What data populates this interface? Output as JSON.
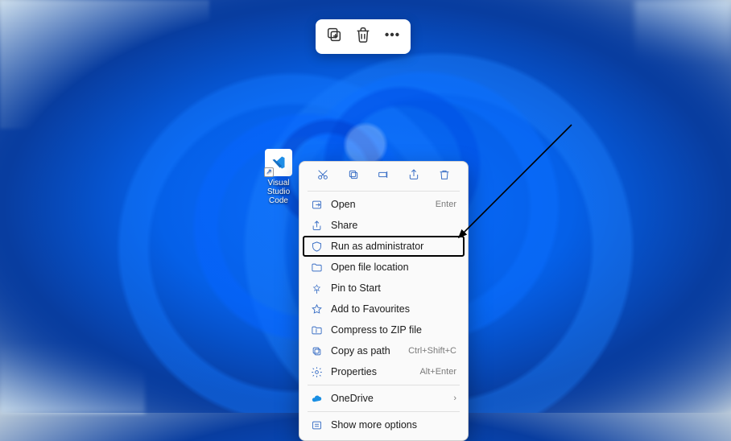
{
  "overlay_toolbar": {
    "icons": [
      "copy-add-icon",
      "trash-icon",
      "more-icon"
    ]
  },
  "desktop_icon": {
    "label": "Visual Studio Code"
  },
  "context_menu": {
    "top_icons": [
      "cut-icon",
      "copy-icon",
      "rename-icon",
      "share-icon",
      "delete-icon"
    ],
    "items": [
      {
        "icon": "open-icon",
        "label": "Open",
        "shortcut": "Enter"
      },
      {
        "icon": "share-icon",
        "label": "Share",
        "shortcut": ""
      },
      {
        "icon": "shield-icon",
        "label": "Run as administrator",
        "shortcut": "",
        "highlight": true
      },
      {
        "icon": "folder-icon",
        "label": "Open file location",
        "shortcut": ""
      },
      {
        "icon": "pin-icon",
        "label": "Pin to Start",
        "shortcut": ""
      },
      {
        "icon": "star-icon",
        "label": "Add to Favourites",
        "shortcut": ""
      },
      {
        "icon": "zip-icon",
        "label": "Compress to ZIP file",
        "shortcut": ""
      },
      {
        "icon": "copypath-icon",
        "label": "Copy as path",
        "shortcut": "Ctrl+Shift+C"
      },
      {
        "icon": "properties-icon",
        "label": "Properties",
        "shortcut": "Alt+Enter"
      }
    ],
    "cloud": {
      "icon": "cloud-icon",
      "label": "OneDrive"
    },
    "more": {
      "icon": "more-icon",
      "label": "Show more options"
    }
  }
}
